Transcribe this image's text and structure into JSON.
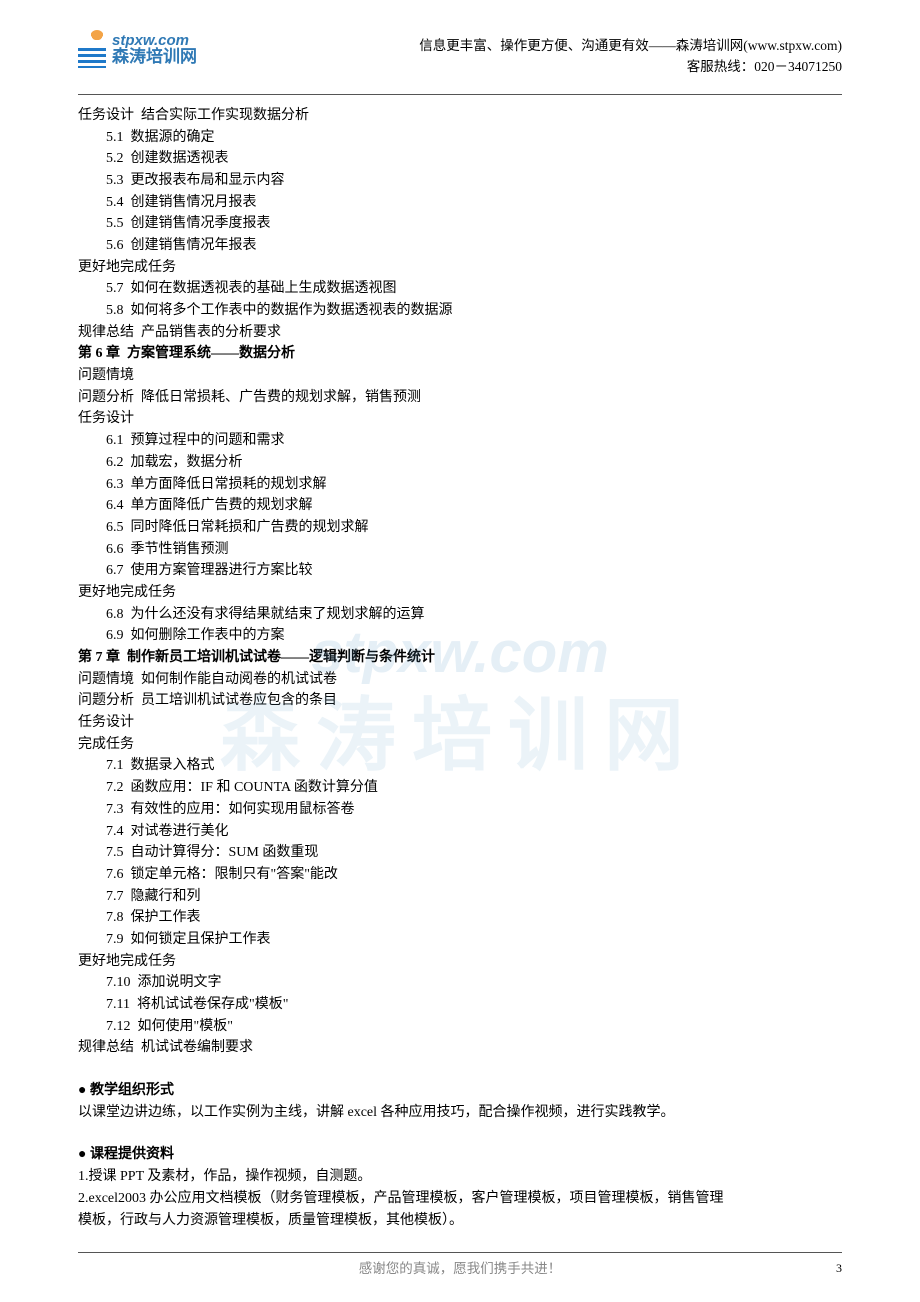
{
  "header": {
    "logo_url": "stpxw.com",
    "logo_cn": "森涛培训网",
    "tagline": "信息更丰富、操作更方便、沟通更有效——森涛培训网(www.stpxw.com)",
    "hotline": "客服热线：020－34071250"
  },
  "watermark": {
    "url": "stpxw.com",
    "cn": "森涛培训网"
  },
  "lines": [
    {
      "t": "任务设计  结合实际工作实现数据分析",
      "cls": ""
    },
    {
      "t": "5.1  数据源的确定",
      "cls": "indent1"
    },
    {
      "t": "5.2  创建数据透视表",
      "cls": "indent1"
    },
    {
      "t": "5.3  更改报表布局和显示内容",
      "cls": "indent1"
    },
    {
      "t": "5.4  创建销售情况月报表",
      "cls": "indent1"
    },
    {
      "t": "5.5  创建销售情况季度报表",
      "cls": "indent1"
    },
    {
      "t": "5.6  创建销售情况年报表",
      "cls": "indent1"
    },
    {
      "t": "更好地完成任务",
      "cls": ""
    },
    {
      "t": "5.7  如何在数据透视表的基础上生成数据透视图",
      "cls": "indent1"
    },
    {
      "t": "5.8  如何将多个工作表中的数据作为数据透视表的数据源",
      "cls": "indent1"
    },
    {
      "t": "规律总结  产品销售表的分析要求",
      "cls": ""
    },
    {
      "t": "第 6 章  方案管理系统——数据分析",
      "cls": "bold"
    },
    {
      "t": "问题情境",
      "cls": ""
    },
    {
      "t": "问题分析  降低日常损耗、广告费的规划求解，销售预测",
      "cls": ""
    },
    {
      "t": "任务设计",
      "cls": ""
    },
    {
      "t": "6.1  预算过程中的问题和需求",
      "cls": "indent1"
    },
    {
      "t": "6.2  加载宏，数据分析",
      "cls": "indent1"
    },
    {
      "t": "6.3  单方面降低日常损耗的规划求解",
      "cls": "indent1"
    },
    {
      "t": "6.4  单方面降低广告费的规划求解",
      "cls": "indent1"
    },
    {
      "t": "6.5  同时降低日常耗损和广告费的规划求解",
      "cls": "indent1"
    },
    {
      "t": "6.6  季节性销售预测",
      "cls": "indent1"
    },
    {
      "t": "6.7  使用方案管理器进行方案比较",
      "cls": "indent1"
    },
    {
      "t": "更好地完成任务",
      "cls": ""
    },
    {
      "t": "6.8  为什么还没有求得结果就结束了规划求解的运算",
      "cls": "indent1"
    },
    {
      "t": "6.9  如何删除工作表中的方案",
      "cls": "indent1"
    },
    {
      "t": "第 7 章  制作新员工培训机试试卷——逻辑判断与条件统计",
      "cls": "bold"
    },
    {
      "t": "问题情境  如何制作能自动阅卷的机试试卷",
      "cls": ""
    },
    {
      "t": "问题分析  员工培训机试试卷应包含的条目",
      "cls": ""
    },
    {
      "t": "任务设计",
      "cls": ""
    },
    {
      "t": "完成任务",
      "cls": ""
    },
    {
      "t": "7.1  数据录入格式",
      "cls": "indent1"
    },
    {
      "t": "7.2  函数应用：IF 和 COUNTA 函数计算分值",
      "cls": "indent1"
    },
    {
      "t": "7.3  有效性的应用：如何实现用鼠标答卷",
      "cls": "indent1"
    },
    {
      "t": "7.4  对试卷进行美化",
      "cls": "indent1"
    },
    {
      "t": "7.5  自动计算得分：SUM 函数重现",
      "cls": "indent1"
    },
    {
      "t": "7.6  锁定单元格：限制只有\"答案\"能改",
      "cls": "indent1"
    },
    {
      "t": "7.7  隐藏行和列",
      "cls": "indent1"
    },
    {
      "t": "7.8  保护工作表",
      "cls": "indent1"
    },
    {
      "t": "7.9  如何锁定且保护工作表",
      "cls": "indent1"
    },
    {
      "t": "更好地完成任务",
      "cls": ""
    },
    {
      "t": "7.10  添加说明文字",
      "cls": "indent1"
    },
    {
      "t": "7.11  将机试试卷保存成\"模板\"",
      "cls": "indent1"
    },
    {
      "t": "7.12  如何使用\"模板\"",
      "cls": "indent1"
    },
    {
      "t": "规律总结  机试试卷编制要求",
      "cls": ""
    },
    {
      "t": "",
      "cls": "blank"
    },
    {
      "t": "● 教学组织形式",
      "cls": "bold"
    },
    {
      "t": "以课堂边讲边练，以工作实例为主线，讲解 excel 各种应用技巧，配合操作视频，进行实践教学。",
      "cls": ""
    },
    {
      "t": "",
      "cls": "blank"
    },
    {
      "t": "● 课程提供资料",
      "cls": "bold"
    },
    {
      "t": "1.授课 PPT 及素材，作品，操作视频，自测题。",
      "cls": ""
    },
    {
      "t": "2.excel2003 办公应用文档模板（财务管理模板，产品管理模板，客户管理模板，项目管理模板，销售管理",
      "cls": ""
    },
    {
      "t": "模板，行政与人力资源管理模板，质量管理模板，其他模板）。",
      "cls": ""
    }
  ],
  "footer": {
    "text": "感谢您的真诚，愿我们携手共进！",
    "page": "3"
  }
}
